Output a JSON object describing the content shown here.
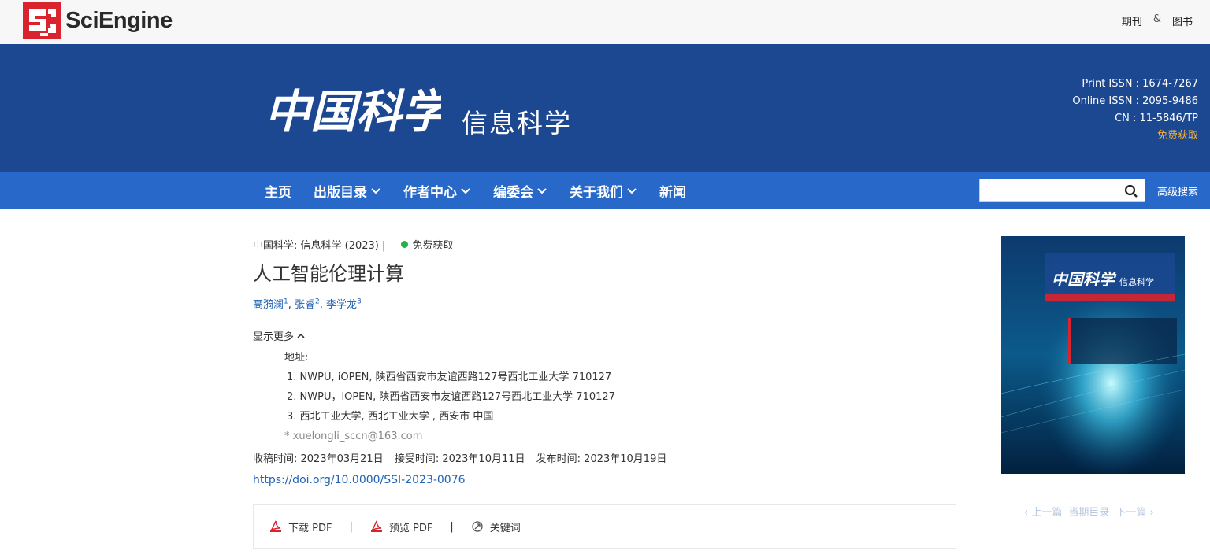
{
  "header": {
    "brand": "SciEngine",
    "links": [
      "期刊",
      "&",
      "图书"
    ]
  },
  "banner": {
    "journal_calligraphy": "中国科学",
    "journal_subtitle": "信息科学",
    "issn": {
      "print": "Print ISSN : 1674-7267",
      "online": "Online ISSN : 2095-9486",
      "cn": "CN : 11-5846/TP",
      "free_access": "免费获取"
    }
  },
  "nav": {
    "items": [
      {
        "label": "主页",
        "dropdown": false
      },
      {
        "label": "出版目录",
        "dropdown": true
      },
      {
        "label": "作者中心",
        "dropdown": true
      },
      {
        "label": "编委会",
        "dropdown": true
      },
      {
        "label": "关于我们",
        "dropdown": true
      },
      {
        "label": "新闻",
        "dropdown": false
      }
    ],
    "search_value": "",
    "advanced_search": "高级搜索"
  },
  "article": {
    "crumb": "中国科学: 信息科学 (2023) |",
    "open_access": "免费获取",
    "title": "人工智能伦理计算",
    "authors": [
      {
        "name": "高漪澜",
        "aff": "1"
      },
      {
        "name": "张睿",
        "aff": "2"
      },
      {
        "name": "李学龙",
        "aff": "3"
      }
    ],
    "show_more": "显示更多",
    "address_label": "地址:",
    "affiliations": [
      "1. NWPU, iOPEN, 陕西省西安市友谊西路127号西北工业大学 710127",
      "2. NWPU，iOPEN, 陕西省西安市友谊西路127号西北工业大学 710127",
      "3. 西北工业大学, 西北工业大学 , 西安市 中国"
    ],
    "email": "* xuelongli_sccn@163.com",
    "dates": {
      "received": "收稿时间: 2023年03月21日",
      "accepted": "接受时间: 2023年10月11日",
      "published": "发布时间: 2023年10月19日"
    },
    "doi": "https://doi.org/10.0000/SSI-2023-0076"
  },
  "toolbar": {
    "download_pdf": "下载 PDF",
    "preview_pdf": "预览 PDF",
    "keywords": "关键词",
    "separator": "|"
  },
  "cover": {
    "prev": "‹ 上一篇",
    "current": "当期目录",
    "next": "下一篇 ›"
  },
  "colors": {
    "banner": "#1b4891",
    "nav": "#2768c9",
    "link": "#2062b3",
    "accent_orange": "#f5b13b",
    "open_access_green": "#22b14c"
  }
}
